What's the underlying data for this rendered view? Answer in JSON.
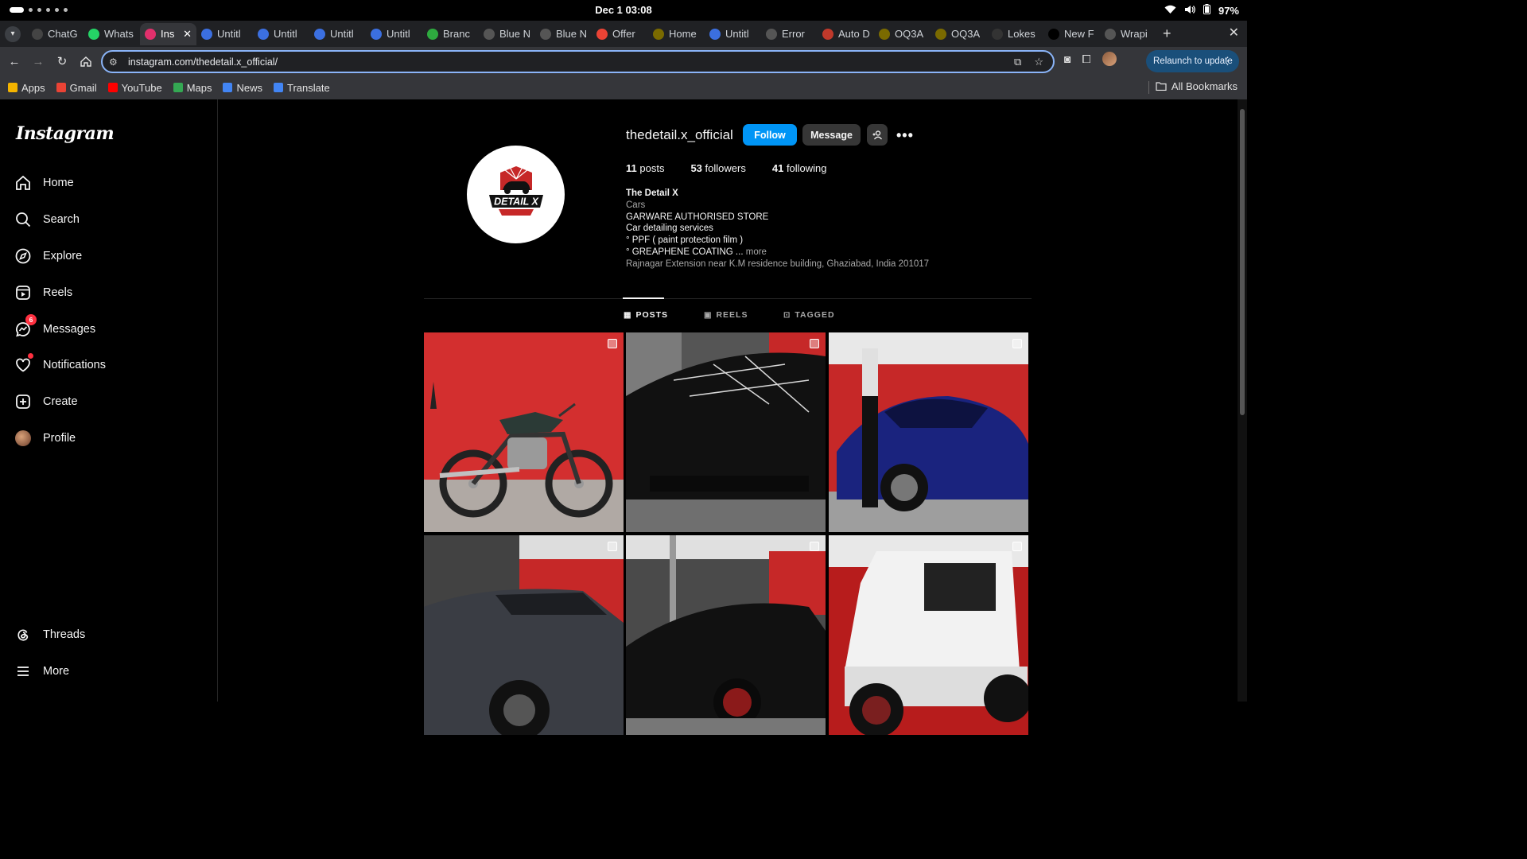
{
  "os": {
    "clock": "Dec 1  03:08",
    "battery": "97%"
  },
  "tabs": [
    {
      "label": "ChatG",
      "icon": "openai-icon",
      "color": "#444"
    },
    {
      "label": "Whats",
      "icon": "whatsapp-icon",
      "color": "#25d366"
    },
    {
      "label": "Ins",
      "icon": "instagram-icon",
      "color": "#e1306c",
      "active": true
    },
    {
      "label": "Untitl",
      "icon": "canva-icon",
      "color": "#3b6fe0"
    },
    {
      "label": "Untitl",
      "icon": "canva-icon",
      "color": "#3b6fe0"
    },
    {
      "label": "Untitl",
      "icon": "canva-icon",
      "color": "#3b6fe0"
    },
    {
      "label": "Untitl",
      "icon": "canva-icon",
      "color": "#3b6fe0"
    },
    {
      "label": "Branc",
      "icon": "branch-icon",
      "color": "#2eaa3f"
    },
    {
      "label": "Blue N",
      "icon": "globe-icon",
      "color": "#555"
    },
    {
      "label": "Blue N",
      "icon": "globe-icon",
      "color": "#555"
    },
    {
      "label": "Offer",
      "icon": "gmail-icon",
      "color": "#ea4335"
    },
    {
      "label": "Home",
      "icon": "oq-icon",
      "color": "#7a6a00"
    },
    {
      "label": "Untitl",
      "icon": "canva-icon",
      "color": "#3b6fe0"
    },
    {
      "label": "Error",
      "icon": "globe-icon",
      "color": "#555"
    },
    {
      "label": "Auto D",
      "icon": "auto-icon",
      "color": "#c0392b"
    },
    {
      "label": "OQ3A",
      "icon": "oq-icon",
      "color": "#7a6a00"
    },
    {
      "label": "OQ3A",
      "icon": "oq-icon",
      "color": "#7a6a00"
    },
    {
      "label": "Lokes",
      "icon": "github-icon",
      "color": "#333"
    },
    {
      "label": "New F",
      "icon": "vercel-icon",
      "color": "#000"
    },
    {
      "label": "Wrapi",
      "icon": "globe-icon",
      "color": "#555"
    }
  ],
  "address_bar": {
    "url": "instagram.com/thedetail.x_official/"
  },
  "relaunch": {
    "label": "Relaunch to update"
  },
  "bookmarks": [
    {
      "label": "Apps",
      "icon": "apps-grid-icon"
    },
    {
      "label": "Gmail",
      "icon": "gmail-icon"
    },
    {
      "label": "YouTube",
      "icon": "youtube-icon"
    },
    {
      "label": "Maps",
      "icon": "maps-icon"
    },
    {
      "label": "News",
      "icon": "news-icon"
    },
    {
      "label": "Translate",
      "icon": "translate-icon"
    }
  ],
  "all_bookmarks": "All Bookmarks",
  "sidebar": {
    "logo": "Instagram",
    "items": [
      {
        "label": "Home",
        "icon": "home-icon"
      },
      {
        "label": "Search",
        "icon": "search-icon"
      },
      {
        "label": "Explore",
        "icon": "compass-icon"
      },
      {
        "label": "Reels",
        "icon": "reels-icon"
      },
      {
        "label": "Messages",
        "icon": "messenger-icon",
        "badge": "6"
      },
      {
        "label": "Notifications",
        "icon": "heart-icon"
      },
      {
        "label": "Create",
        "icon": "plus-square-icon"
      },
      {
        "label": "Profile",
        "icon": "avatar"
      },
      {
        "label": "Threads",
        "icon": "threads-icon"
      },
      {
        "label": "More",
        "icon": "hamburger-icon"
      }
    ]
  },
  "profile": {
    "username": "thedetail.x_official",
    "follow_label": "Follow",
    "message_label": "Message",
    "logo_text": "DETAIL X",
    "stats": {
      "posts_count": "11",
      "posts_label": "posts",
      "followers_count": "53",
      "followers_label": "followers",
      "following_count": "41",
      "following_label": "following"
    },
    "bio": {
      "name": "The Detail X",
      "category": "Cars",
      "lines": [
        "GARWARE AUTHORISED STORE",
        "Car detailing services",
        "° PPF ( paint protection film )",
        "° GREAPHENE COATING ..."
      ],
      "more": "more",
      "address": "Rajnagar Extension near K.M residence building, Ghaziabad, India 201017"
    }
  },
  "profile_tabs": [
    {
      "label": "POSTS",
      "icon": "grid-icon",
      "active": true
    },
    {
      "label": "REELS",
      "icon": "reels-icon"
    },
    {
      "label": "TAGGED",
      "icon": "tag-icon"
    }
  ],
  "posts": [
    {
      "subject": "motorcycle-post",
      "bg": "#c62828"
    },
    {
      "subject": "black-car-post",
      "bg": "#1b1b1b"
    },
    {
      "subject": "blue-hatchback-post",
      "bg": "#b71c1c"
    },
    {
      "subject": "grey-suv-post",
      "bg": "#c62828"
    },
    {
      "subject": "black-sedan-post",
      "bg": "#2a2a2a"
    },
    {
      "subject": "white-offroader-post",
      "bg": "#b71c1c"
    }
  ]
}
